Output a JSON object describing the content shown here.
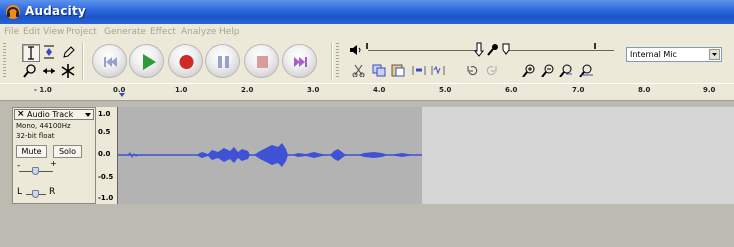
{
  "window": {
    "title": "Audacity"
  },
  "menu": [
    "File",
    "Edit",
    "View",
    "Project",
    "Generate",
    "Effect",
    "Analyze",
    "Help"
  ],
  "tools": {
    "selection_tool": "selection-tool",
    "envelope_tool": "envelope-tool",
    "draw_tool": "draw-tool",
    "zoom_tool": "zoom-tool",
    "timeshift_tool": "timeshift-tool",
    "multi_tool": "multi-tool"
  },
  "control_buttons": [
    "skip-to-start",
    "play",
    "record",
    "pause",
    "stop",
    "skip-to-end"
  ],
  "device": {
    "selected": "Internal Mic"
  },
  "ruler": {
    "labels": [
      "- 1.0",
      "0.0",
      "1.0",
      "2.0",
      "3.0",
      "4.0",
      "5.0",
      "6.0",
      "7.0",
      "8.0",
      "9.0"
    ]
  },
  "track": {
    "name": "Audio Track",
    "info_line1": "Mono, 44100Hz",
    "info_line2": "32-bit float",
    "mute_label": "Mute",
    "solo_label": "Solo",
    "gain_minus": "-",
    "gain_plus": "+",
    "pan_left": "L",
    "pan_right": "R",
    "amplitude_labels": [
      "1.0",
      "0.5",
      "0.0",
      "-0.5",
      "-1.0"
    ]
  },
  "colors": {
    "waveform": "#3f51d4",
    "clip_bg": "#b3b3b3",
    "title_blue": "#2b67dc"
  }
}
